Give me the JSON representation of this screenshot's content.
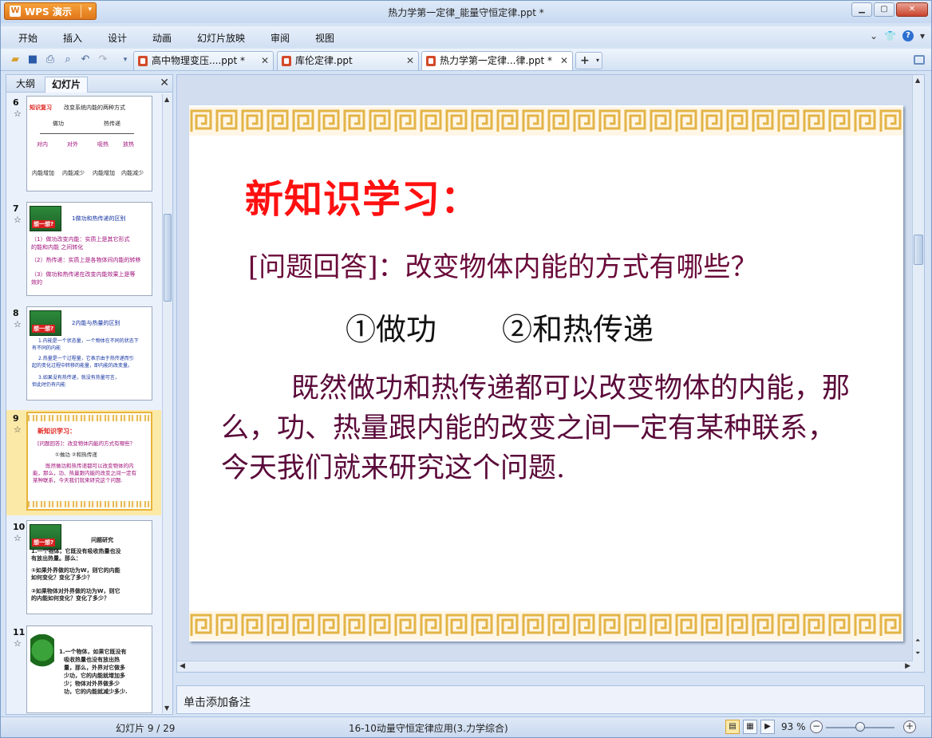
{
  "app": {
    "title": "WPS 演示"
  },
  "window": {
    "title": "热力学第一定律_能量守恒定律.ppt *"
  },
  "menu": [
    "开始",
    "插入",
    "设计",
    "动画",
    "幻灯片放映",
    "审阅",
    "视图"
  ],
  "doc_tabs": [
    {
      "label": "高中物理变压....ppt *",
      "active": false
    },
    {
      "label": "库伦定律.ppt",
      "active": false
    },
    {
      "label": "热力学第一定律...律.ppt *",
      "active": true
    }
  ],
  "left_panel": {
    "tabs": [
      "大纲",
      "幻灯片"
    ],
    "active_tab": "幻灯片",
    "thumbnails": [
      {
        "number": "6",
        "title": "知识复习",
        "subtitle": "改变系统内能的两种方式",
        "lines": [
          "做功",
          "热传递",
          "对内",
          "对外",
          "吸热",
          "放热",
          "内能增加",
          "内能减少",
          "内能增加",
          "内能减少"
        ]
      },
      {
        "number": "7",
        "badge": "想一想?",
        "title": "1做功和热传递的区别",
        "lines": [
          "（1）做功改变内能：实质上是其它形式",
          "的能和内能    之间转化",
          "（2）热传递：实质上是各物体间内能的转移",
          "（3）做功和热传递在改变内能效果上是等",
          "效的"
        ]
      },
      {
        "number": "8",
        "badge": "想一想?",
        "title": "2内能与热量的区别",
        "lines": [
          "1.内能是一个状态量，一个物体在不同的状态下",
          "有不同的内能",
          "2.热量是一个过程量，它表示由于热传递而引",
          "起的变化过程中转移的能量，即内能的改变量。",
          "3.如果没有热传递，就没有热量可言，",
          "但此时仍有内能"
        ]
      },
      {
        "number": "9",
        "title": "新知识学习：",
        "lines": [
          "[问题回答]：改变物体内能的方式有哪些？",
          "①做功     ②和热传递",
          "既然做功和热传递都可以改变物体的内",
          "能，那么，功、热量跟内能的改变之间一定有",
          "某种联系，今天我们就来研究这个问题."
        ],
        "selected": true
      },
      {
        "number": "10",
        "badge": "想一想?",
        "title": "问题研究",
        "lines": [
          "1.一个物体，它既没有吸收热量也没",
          "有放出热量。那么：",
          "①如果外界做的功为W，则它的内能",
          "如何变化？变化了多少？",
          "②如果物体对外界做的功为W，则它",
          "的内能如何变化？变化了多少？"
        ]
      },
      {
        "number": "11",
        "lines": [
          "1.一个物体，如果它既没有",
          "吸收热量也没有放出热",
          "量，那么，外界对它做多",
          "少功，它的内能就增加多",
          "少；物体对外界做多少",
          "功，它的内能就减少多少."
        ]
      }
    ]
  },
  "slide": {
    "heading": "新知识学习：",
    "question": "[问题回答]：改变物体内能的方式有哪些？",
    "answer1": "①做功",
    "answer2": "②和热传递",
    "body": "既然做功和热传递都可以改变物体的内能，那么，功、热量跟内能的改变之间一定有某种联系，今天我们就来研究这个问题.",
    "colors": {
      "heading": "#ff1010",
      "question": "#6a0a3a",
      "body": "#5a0a3a",
      "border": "#e3b447"
    }
  },
  "notes": {
    "placeholder": "单击添加备注"
  },
  "status": {
    "slide_indicator": "幻灯片 9 / 29",
    "template": "16-10动量守恒定律应用(3.力学综合)",
    "zoom": "93 %",
    "zoom_value": 93
  }
}
